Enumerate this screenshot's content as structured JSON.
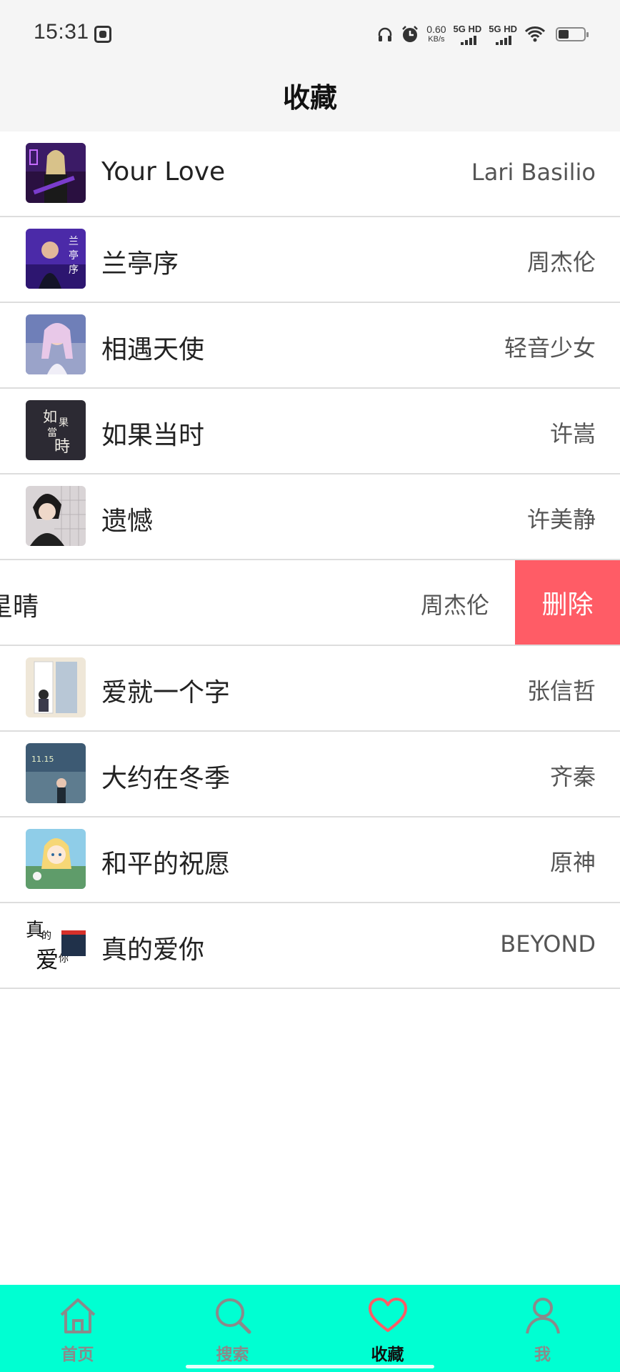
{
  "status_bar": {
    "time": "15:31",
    "net_speed_value": "0.60",
    "net_speed_unit": "KB/s",
    "sim1": "5G HD",
    "sim2": "5G HD",
    "icons": [
      "headphones-icon",
      "alarm-icon",
      "wifi-icon",
      "battery-icon"
    ]
  },
  "header": {
    "title": "收藏"
  },
  "favorites": [
    {
      "title": "Your Love",
      "artist": "Lari Basilio"
    },
    {
      "title": "兰亭序",
      "artist": "周杰伦"
    },
    {
      "title": "相遇天使",
      "artist": "轻音少女"
    },
    {
      "title": "如果当时",
      "artist": "许嵩"
    },
    {
      "title": "遗憾",
      "artist": "许美静"
    },
    {
      "title": "星晴",
      "artist": "周杰伦",
      "swiped": true,
      "delete_label": "删除"
    },
    {
      "title": "爱就一个字",
      "artist": "张信哲"
    },
    {
      "title": "大约在冬季",
      "artist": "齐秦"
    },
    {
      "title": "和平的祝愿",
      "artist": "原神"
    },
    {
      "title": "真的爱你",
      "artist": "BEYOND"
    }
  ],
  "tabbar": {
    "tabs": [
      {
        "label": "首页",
        "icon": "home-icon"
      },
      {
        "label": "搜索",
        "icon": "search-icon"
      },
      {
        "label": "收藏",
        "icon": "heart-icon",
        "active": true
      },
      {
        "label": "我",
        "icon": "user-icon"
      }
    ]
  },
  "colors": {
    "tabbar_bg": "#00ffd2",
    "delete_bg": "#ff5c66",
    "active_icon": "#ff5c66",
    "header_bg": "#f5f5f5"
  }
}
